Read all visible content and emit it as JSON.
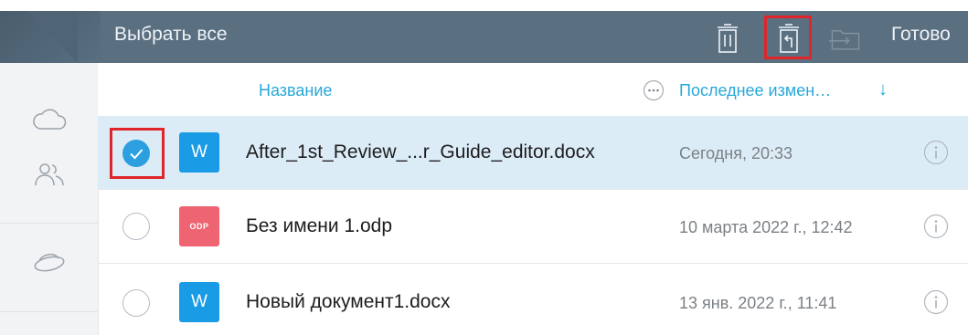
{
  "toolbar": {
    "select_all_label": "Выбрать все",
    "done_label": "Готово",
    "icons": [
      "trash-icon",
      "restore-icon",
      "move-to-folder-icon"
    ]
  },
  "sidebar": {
    "icons": [
      "cloud-icon",
      "shared-users-icon",
      "storage-disk-icon"
    ]
  },
  "columns": {
    "name": "Название",
    "modified": "Последнее измен…",
    "sort_indicator": "↓"
  },
  "files": [
    {
      "name": "After_1st_Review_...r_Guide_editor.docx",
      "modified": "Сегодня, 20:33",
      "type": "docx",
      "icon_text": "W",
      "selected": true
    },
    {
      "name": "Без имени 1.odp",
      "modified": "10 марта 2022 г., 12:42",
      "type": "odp",
      "icon_text": "ODP",
      "selected": false
    },
    {
      "name": "Новый документ1.docx",
      "modified": "13 янв. 2022 г., 11:41",
      "type": "docx",
      "icon_text": "W",
      "selected": false
    }
  ],
  "colors": {
    "toolbar_bg": "#5a6f80",
    "accent": "#27a8d9",
    "selected_row": "#dcecf6",
    "checkbox_on": "#2b9fe0",
    "highlight": "#e0252a",
    "doc_icon": "#1a9be6",
    "odp_icon": "#ee6472"
  }
}
